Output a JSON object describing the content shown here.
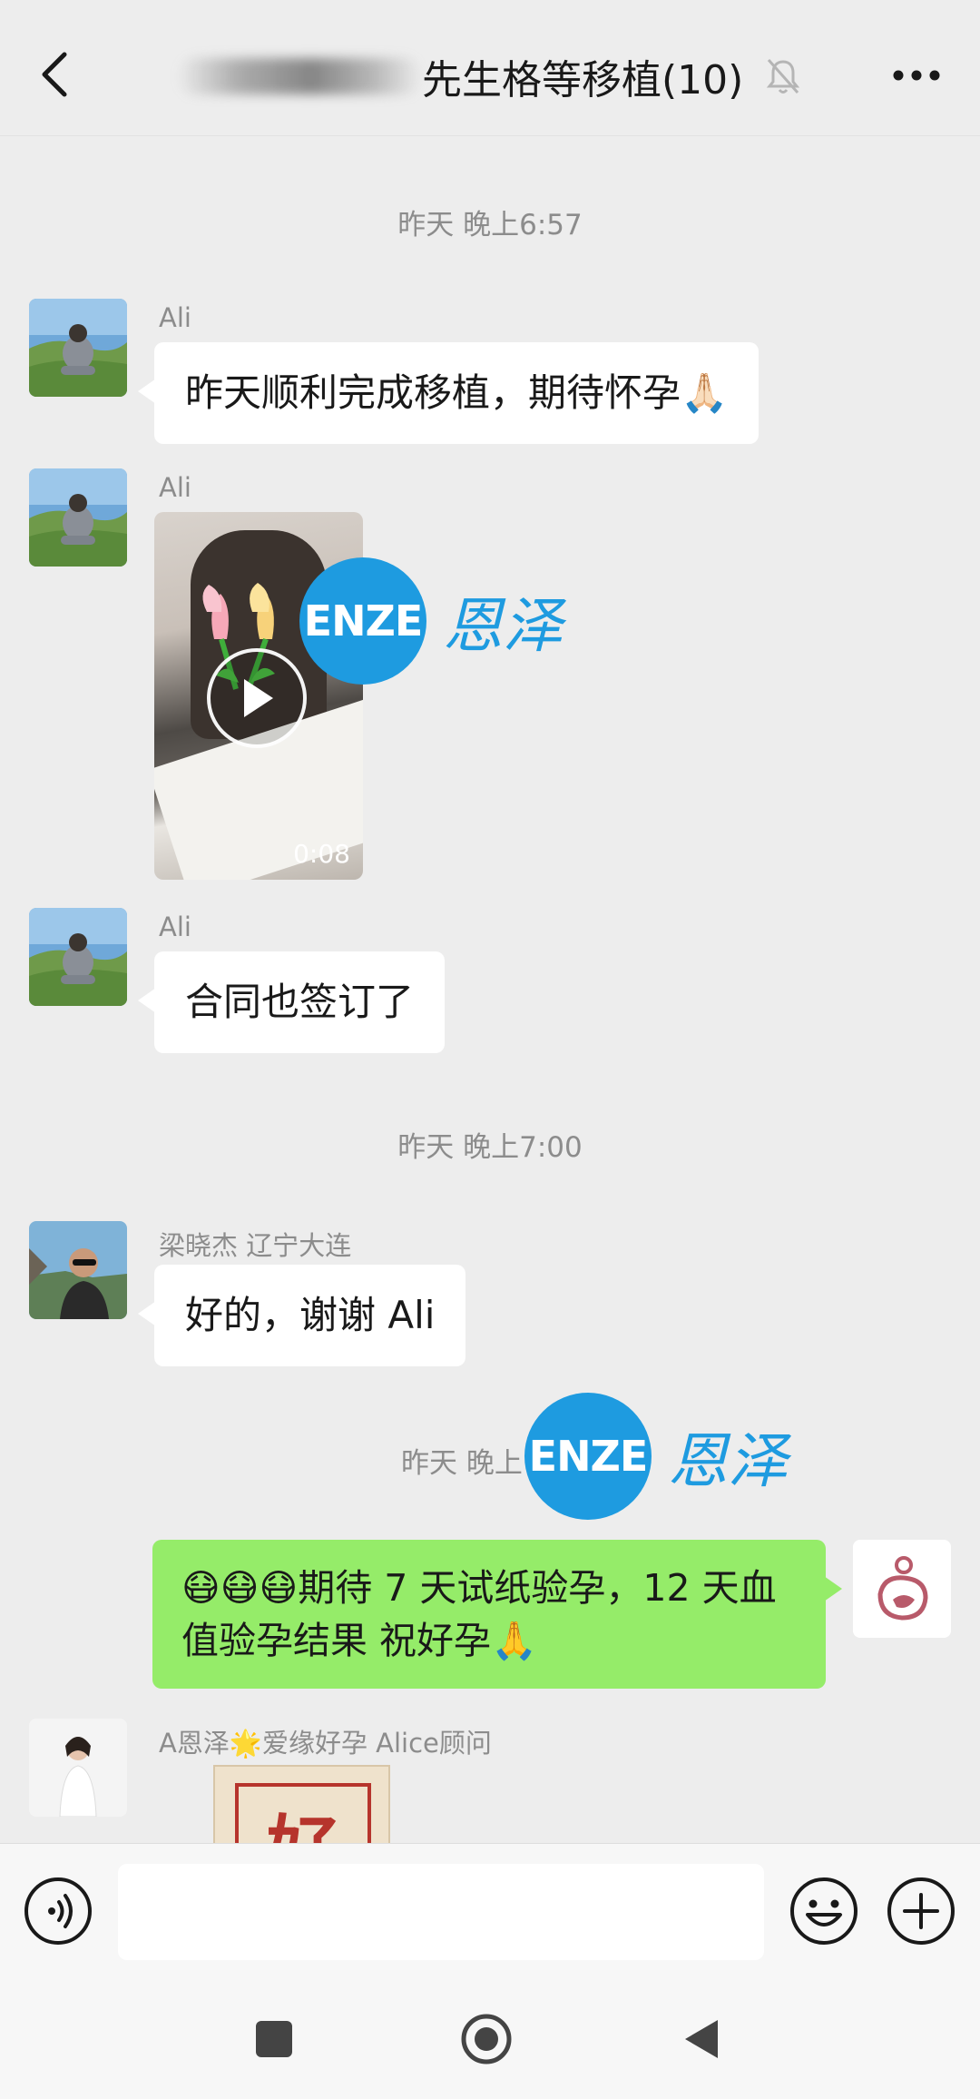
{
  "header": {
    "title": "先生格等移植(10)"
  },
  "messages": {
    "time1": "昨天 晚上6:57",
    "m1": {
      "sender": "Ali",
      "text": "昨天顺利完成移植，期待怀孕🙏🏻"
    },
    "m2": {
      "sender": "Ali",
      "video_duration": "0:08"
    },
    "m3": {
      "sender": "Ali",
      "text": "合同也签订了"
    },
    "time2": "昨天 晚上7:00",
    "m4": {
      "sender": "梁晓杰 辽宁大连",
      "text": "好的，谢谢 Ali"
    },
    "time3": "昨天 晚上",
    "m5": {
      "text": "😷😷😷期待 7 天试纸验孕，12 天血值验孕结果 祝好孕🙏"
    },
    "m6": {
      "sender": "A恩泽🌟爱缘好孕 Alice顾问",
      "sticker_text": "好"
    }
  },
  "watermark": {
    "logo_text": "ENZE",
    "cn_text": "恩泽"
  },
  "input": {
    "placeholder": ""
  },
  "colors": {
    "accent_blue": "#1e9be0",
    "bubble_green": "#95ec69",
    "background": "#ededed"
  }
}
